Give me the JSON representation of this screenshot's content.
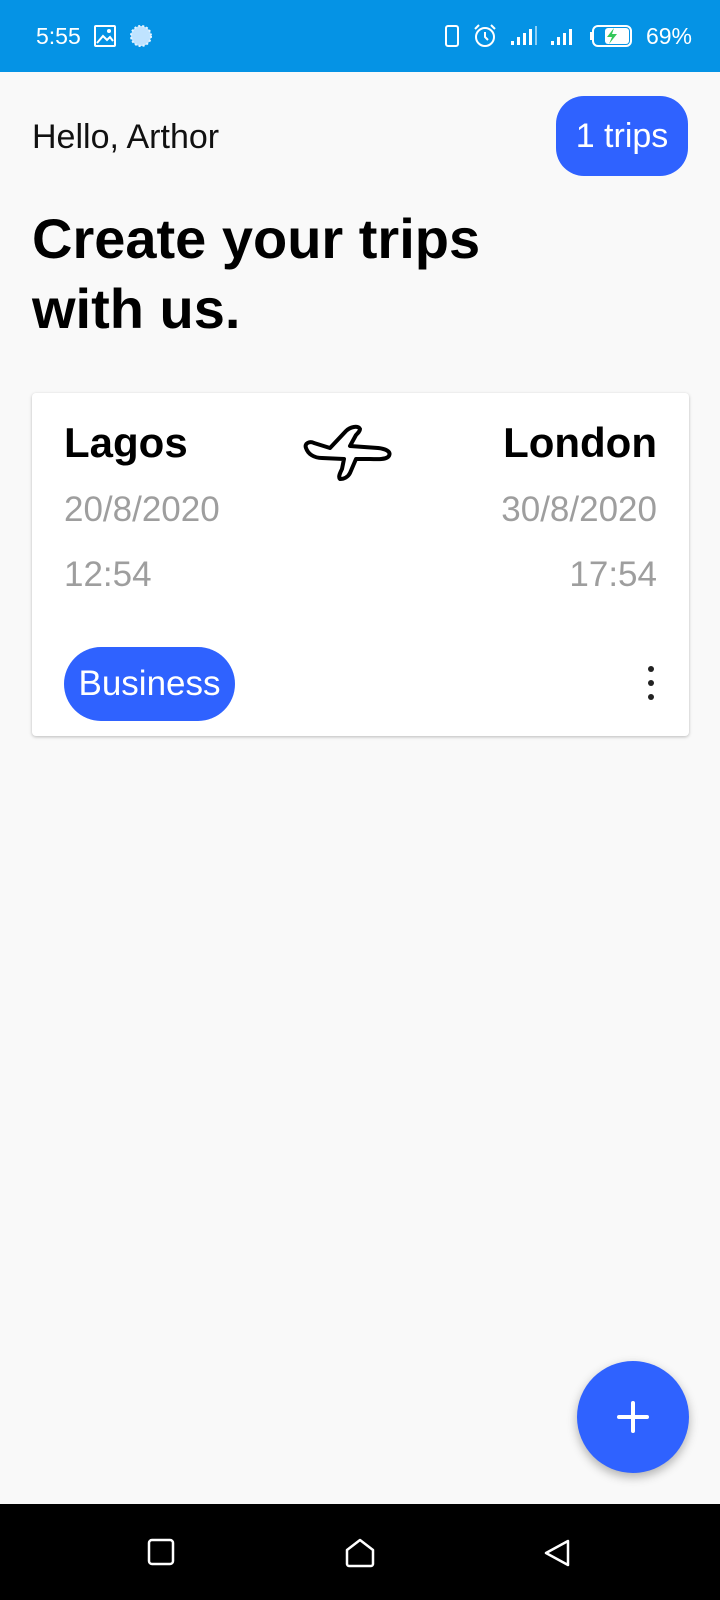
{
  "status_bar": {
    "time": "5:55",
    "battery_percent": "69%",
    "background_color": "#0593e5",
    "left_icons": [
      "image-icon",
      "loading-dot-icon"
    ],
    "right_icons": [
      "phone-vibrate-icon",
      "alarm-icon",
      "signal-icon",
      "signal-icon",
      "battery-charging-icon"
    ]
  },
  "header": {
    "greeting": "Hello, Arthor",
    "trips_count_label": "1 trips",
    "title": "Create your trips\nwith us."
  },
  "trips": [
    {
      "from_city": "Lagos",
      "to_city": "London",
      "departure_date": "20/8/2020",
      "arrival_date": "30/8/2020",
      "departure_time": "12:54",
      "arrival_time": "17:54",
      "category": "Business",
      "icon": "airplane-icon",
      "menu_icon": "more-vertical-icon"
    }
  ],
  "fab": {
    "icon": "plus-icon"
  },
  "nav_bar": {
    "icons": [
      "recent-apps-icon",
      "home-icon",
      "back-icon"
    ]
  },
  "colors": {
    "accent": "#2f62ff",
    "muted_text": "#9e9e9e",
    "background": "#f9f9f9"
  }
}
